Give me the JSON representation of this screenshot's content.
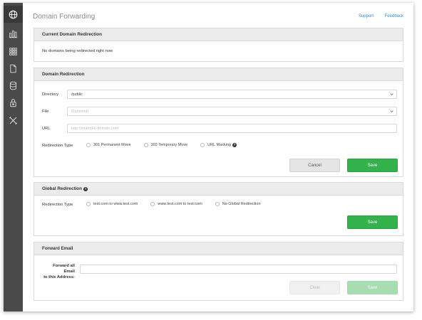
{
  "header": {
    "title": "Domain Forwarding",
    "links": [
      "Support",
      "Feedback"
    ]
  },
  "sidebar": {
    "items": [
      {
        "icon": "globe-icon"
      },
      {
        "icon": "bar-chart-icon"
      },
      {
        "icon": "apps-grid-icon"
      },
      {
        "icon": "document-icon"
      },
      {
        "icon": "database-icon"
      },
      {
        "icon": "lock-icon"
      },
      {
        "icon": "tools-icon"
      }
    ]
  },
  "current_redirection": {
    "heading": "Current Domain Redirection",
    "message": "No domains being redirected right now"
  },
  "domain_redirection": {
    "heading": "Domain Redirection",
    "directory_label": "Directory",
    "directory_value": "/public",
    "file_label": "File",
    "file_placeholder": "(Optional)",
    "url_label": "URL",
    "url_placeholder": "http://example-domain.com",
    "type_label": "Redirection Type",
    "types": [
      "301 Permanent Move",
      "302 Temporary Move",
      "URL Masking"
    ],
    "cancel_label": "Cancel",
    "save_label": "Save"
  },
  "global_redirection": {
    "heading": "Global Redirection",
    "type_label": "Redirection Type",
    "types": [
      "test.com to www.test.com",
      "www.test.com to test.com",
      "No Global Redirection"
    ],
    "save_label": "Save"
  },
  "forward_email": {
    "heading": "Forward Email",
    "label_line1": "Forward all Email",
    "label_line2": "to this Address:",
    "input_value": "",
    "clear_label": "Clear",
    "save_label": "Save"
  },
  "colors": {
    "sidebar": "#4a4a4a",
    "accent_green": "#33b24c",
    "link_blue": "#3a87c8"
  }
}
